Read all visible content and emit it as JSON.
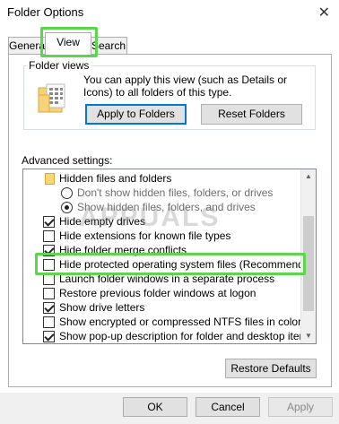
{
  "window": {
    "title": "Folder Options",
    "close_glyph": "✕"
  },
  "tabs": [
    {
      "label": "General"
    },
    {
      "label": "View",
      "selected": true
    },
    {
      "label": "Search"
    }
  ],
  "folder_views": {
    "heading": "Folder views",
    "description": "You can apply this view (such as Details or Icons) to all folders of this type.",
    "apply_button": "Apply to Folders",
    "reset_button": "Reset Folders"
  },
  "advanced": {
    "label": "Advanced settings:",
    "items": [
      {
        "kind": "folder",
        "label": "Hidden files and folders"
      },
      {
        "kind": "radio",
        "checked": false,
        "label": "Don't show hidden files, folders, or drives"
      },
      {
        "kind": "radio",
        "checked": true,
        "label": "Show hidden files, folders, and drives"
      },
      {
        "kind": "checkbox",
        "checked": true,
        "label": "Hide empty drives"
      },
      {
        "kind": "checkbox",
        "checked": false,
        "label": "Hide extensions for known file types"
      },
      {
        "kind": "checkbox",
        "checked": true,
        "label": "Hide folder merge conflicts"
      },
      {
        "kind": "checkbox",
        "checked": false,
        "label": "Hide protected operating system files (Recommended)"
      },
      {
        "kind": "checkbox",
        "checked": false,
        "label": "Launch folder windows in a separate process"
      },
      {
        "kind": "checkbox",
        "checked": false,
        "label": "Restore previous folder windows at logon"
      },
      {
        "kind": "checkbox",
        "checked": true,
        "label": "Show drive letters"
      },
      {
        "kind": "checkbox",
        "checked": false,
        "label": "Show encrypted or compressed NTFS files in color"
      },
      {
        "kind": "checkbox",
        "checked": true,
        "label": "Show pop-up description for folder and desktop items"
      }
    ],
    "restore_button": "Restore Defaults"
  },
  "watermark": "APPUALS",
  "footer": {
    "ok": "OK",
    "cancel": "Cancel",
    "apply": "Apply"
  },
  "colors": {
    "highlight": "#5cd64a",
    "focus_border": "#0078d7"
  },
  "icons": {
    "close": "close-icon",
    "folder_views": "folder-grid-icon",
    "scroll_up": "chevron-up-icon",
    "scroll_down": "chevron-down-icon"
  }
}
